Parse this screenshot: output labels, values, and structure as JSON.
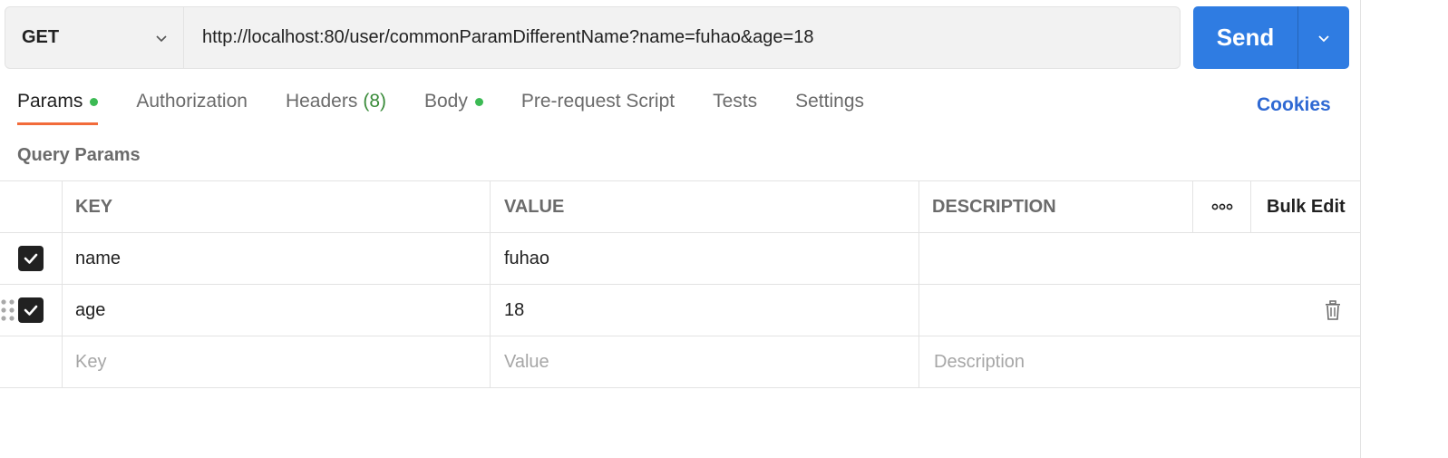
{
  "request": {
    "method": "GET",
    "url": "http://localhost:80/user/commonParamDifferentName?name=fuhao&age=18",
    "send_label": "Send"
  },
  "tabs": [
    {
      "label": "Params",
      "active": true,
      "dot": true
    },
    {
      "label": "Authorization"
    },
    {
      "label": "Headers",
      "count": "(8)"
    },
    {
      "label": "Body",
      "dot": true
    },
    {
      "label": "Pre-request Script"
    },
    {
      "label": "Tests"
    },
    {
      "label": "Settings"
    }
  ],
  "cookies_label": "Cookies",
  "section_title": "Query Params",
  "table": {
    "headers": {
      "key": "KEY",
      "value": "VALUE",
      "description": "DESCRIPTION",
      "more": "◦◦◦",
      "bulk_edit": "Bulk Edit"
    },
    "rows": [
      {
        "checked": true,
        "key": "name",
        "value": "fuhao",
        "description": ""
      },
      {
        "checked": true,
        "key": "age",
        "value": "18",
        "description": ""
      }
    ],
    "placeholders": {
      "key": "Key",
      "value": "Value",
      "description": "Description"
    }
  },
  "colors": {
    "accent": "#2f7ce2",
    "tab_underline": "#f26b3a",
    "dot": "#3cba54",
    "cookies": "#2f69d3"
  },
  "icons": [
    "chevron-down-icon",
    "checkmark-icon",
    "drag-handle-icon",
    "trash-icon",
    "more-icon"
  ]
}
